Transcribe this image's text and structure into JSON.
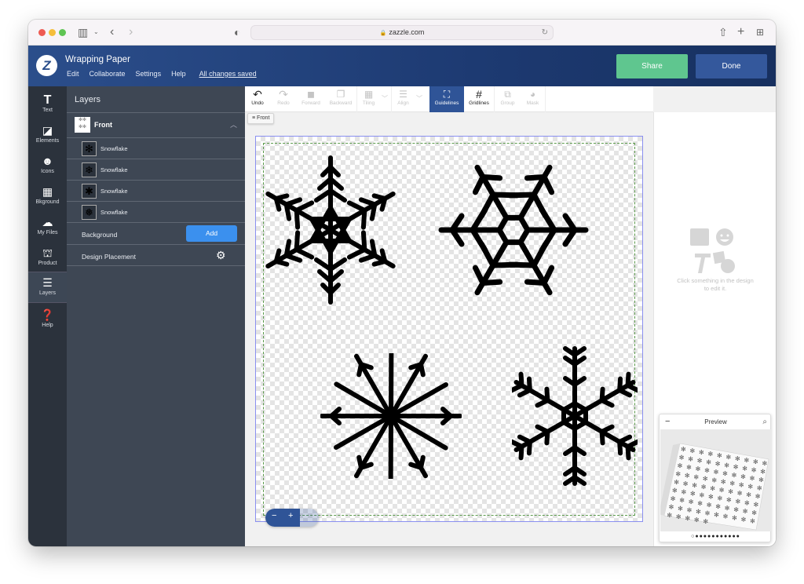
{
  "browser": {
    "url": "zazzle.com"
  },
  "app": {
    "logo_letter": "Z",
    "title": "Wrapping Paper",
    "menu": [
      "Edit",
      "Collaborate",
      "Settings",
      "Help"
    ],
    "save_status": "All changes saved",
    "share_label": "Share",
    "done_label": "Done",
    "colors": {
      "header": "#2b4e8b",
      "share": "#5fc68f",
      "done": "#34589c",
      "accent": "#3b90ee"
    }
  },
  "rail": {
    "items": [
      {
        "label": "Text",
        "icon": "text-icon"
      },
      {
        "label": "Elements",
        "icon": "elements-icon"
      },
      {
        "label": "Icons",
        "icon": "smiley-icon"
      },
      {
        "label": "Bkground",
        "icon": "background-icon"
      },
      {
        "label": "My Files",
        "icon": "upload-cloud-icon"
      },
      {
        "label": "Product",
        "icon": "product-icon"
      },
      {
        "label": "Layers",
        "icon": "layers-icon",
        "active": true
      },
      {
        "label": "Help",
        "icon": "help-icon"
      }
    ]
  },
  "layers": {
    "title": "Layers",
    "group_label": "Front",
    "items": [
      {
        "label": "Snowflake"
      },
      {
        "label": "Snowflake"
      },
      {
        "label": "Snowflake"
      },
      {
        "label": "Snowflake"
      }
    ],
    "background_label": "Background",
    "add_label": "Add",
    "placement_label": "Design Placement"
  },
  "toolbar": {
    "tools": [
      {
        "label": "Undo",
        "enabled": true
      },
      {
        "label": "Redo",
        "enabled": false
      },
      {
        "label": "Forward",
        "enabled": false
      },
      {
        "label": "Backward",
        "enabled": false
      },
      {
        "label": "Tiling",
        "enabled": false
      },
      {
        "label": "Align",
        "enabled": false
      },
      {
        "label": "Guidelines",
        "enabled": true,
        "active": true
      },
      {
        "label": "Gridlines",
        "enabled": true
      },
      {
        "label": "Group",
        "enabled": false
      },
      {
        "label": "Mask",
        "enabled": false
      }
    ],
    "side_chip": "Front"
  },
  "canvas": {
    "zoom_minus": "−",
    "zoom_plus": "+"
  },
  "right_panel": {
    "hint_line1": "Click something in the design",
    "hint_line2": "to edit it."
  },
  "preview": {
    "title": "Preview",
    "minimize": "−",
    "page_count": 12,
    "current_page": 1
  }
}
